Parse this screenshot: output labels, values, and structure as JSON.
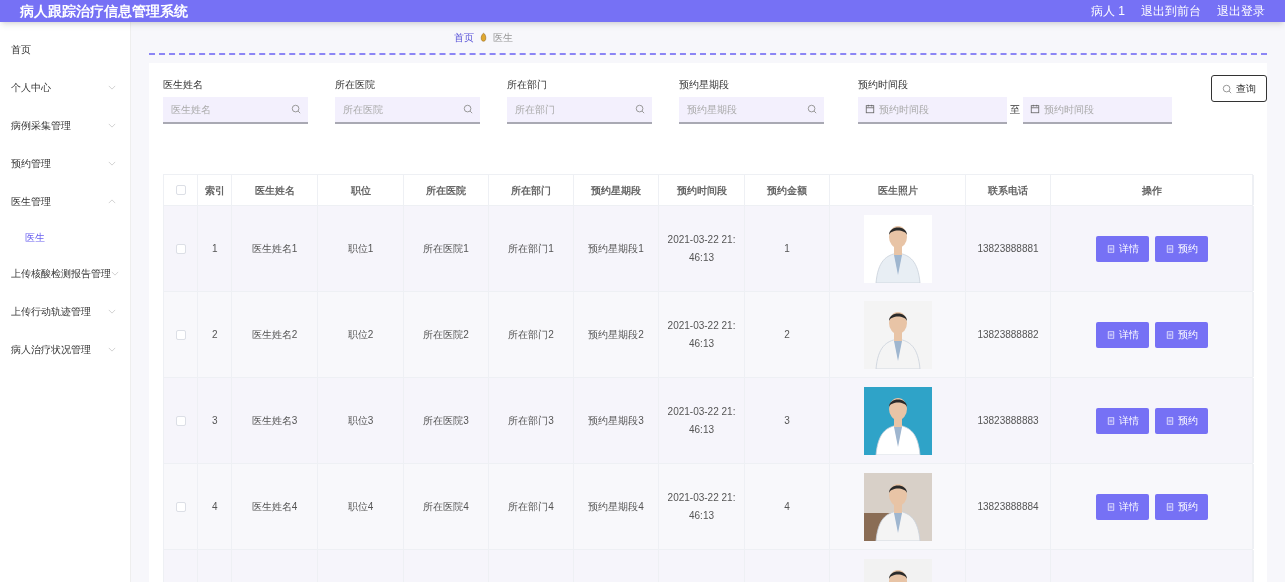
{
  "header": {
    "title": "病人跟踪治疗信息管理系统",
    "links": [
      "病人 1",
      "退出到前台",
      "退出登录"
    ]
  },
  "sidebar": {
    "items": [
      {
        "label": "首页"
      },
      {
        "label": "个人中心",
        "expanded": false
      },
      {
        "label": "病例采集管理",
        "expanded": false
      },
      {
        "label": "预约管理",
        "expanded": false
      },
      {
        "label": "医生管理",
        "expanded": true,
        "children": [
          {
            "label": "医生",
            "selected": true
          }
        ]
      },
      {
        "label": "上传核酸检测报告管理",
        "expanded": false
      },
      {
        "label": "上传行动轨迹管理",
        "expanded": false
      },
      {
        "label": "病人治疗状况管理",
        "expanded": false
      }
    ]
  },
  "breadcrumb": [
    "首页",
    "医生"
  ],
  "filters": [
    {
      "label": "医生姓名",
      "placeholder": "医生姓名"
    },
    {
      "label": "所在医院",
      "placeholder": "所在医院"
    },
    {
      "label": "所在部门",
      "placeholder": "所在部门"
    },
    {
      "label": "预约星期段",
      "placeholder": "预约星期段"
    }
  ],
  "time_filter": {
    "label": "预约时间段",
    "from_placeholder": "预约时间段",
    "separator": "至",
    "to_placeholder": "预约时间段"
  },
  "search_button": "查询",
  "table": {
    "all_checked": false,
    "columns": [
      "索引",
      "医生姓名",
      "职位",
      "所在医院",
      "所在部门",
      "预约星期段",
      "预约时间段",
      "预约金额",
      "医生照片",
      "联系电话",
      "操作"
    ],
    "rows": [
      {
        "checked": false,
        "cells": [
          "1",
          "医生姓名1",
          "职位1",
          "所在医院1",
          "所在部门1",
          "预约星期段1",
          "2021-03-22 21:46:13",
          "1",
          "13823888881"
        ],
        "photo": {
          "kind": "picture"
        },
        "actions": [
          "详情",
          "预约"
        ]
      },
      {
        "checked": false,
        "cells": [
          "2",
          "医生姓名2",
          "职位2",
          "所在医院2",
          "所在部门2",
          "预约星期段2",
          "2021-03-22 21:46:13",
          "2",
          "13823888882"
        ],
        "photo": {
          "kind": "picture"
        },
        "actions": [
          "详情",
          "预约"
        ]
      },
      {
        "checked": false,
        "cells": [
          "3",
          "医生姓名3",
          "职位3",
          "所在医院3",
          "所在部门3",
          "预约星期段3",
          "2021-03-22 21:46:13",
          "3",
          "13823888883"
        ],
        "photo": {
          "kind": "picture"
        },
        "actions": [
          "详情",
          "预约"
        ]
      },
      {
        "checked": false,
        "cells": [
          "4",
          "医生姓名4",
          "职位4",
          "所在医院4",
          "所在部门4",
          "预约星期段4",
          "2021-03-22 21:46:13",
          "4",
          "13823888884"
        ],
        "photo": {
          "kind": "picture"
        },
        "actions": [
          "详情",
          "预约"
        ]
      },
      {
        "photo": {
          "kind": "picture"
        }
      }
    ]
  }
}
